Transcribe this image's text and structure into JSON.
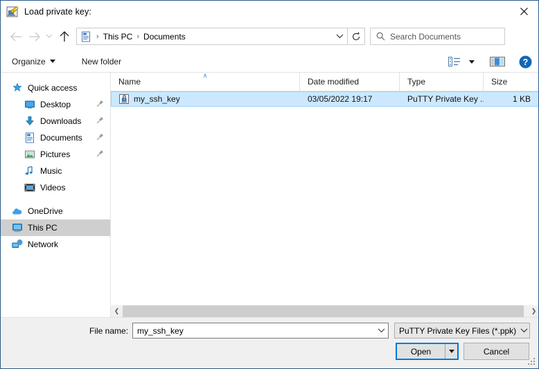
{
  "window": {
    "title": "Load private key:",
    "title_icon": "putty-key-icon",
    "close_label": "✕"
  },
  "nav": {
    "back_icon": "arrow-left-icon",
    "forward_icon": "arrow-right-icon",
    "recent_icon": "chevron-down-icon",
    "up_icon": "arrow-up-icon",
    "address_icon": "documents-folder-icon",
    "breadcrumbs": [
      "This PC",
      "Documents"
    ],
    "separator": "›",
    "dropdown_icon": "chevron-down-icon",
    "refresh_icon": "refresh-icon"
  },
  "search": {
    "placeholder": "Search Documents",
    "icon": "search-icon"
  },
  "toolbar": {
    "organize_label": "Organize",
    "new_folder_label": "New folder",
    "view_icon": "list-view-icon",
    "view_caret_icon": "chevron-down-icon",
    "preview_pane_icon": "preview-pane-icon",
    "help_icon": "help-icon",
    "help_label": "?"
  },
  "sidebar": {
    "items": [
      {
        "label": "Quick access",
        "icon": "star-pin-icon",
        "indent": 0,
        "pinned": false,
        "selected": false
      },
      {
        "label": "Desktop",
        "icon": "desktop-icon",
        "indent": 1,
        "pinned": true,
        "selected": false
      },
      {
        "label": "Downloads",
        "icon": "downloads-icon",
        "indent": 1,
        "pinned": true,
        "selected": false
      },
      {
        "label": "Documents",
        "icon": "documents-icon",
        "indent": 1,
        "pinned": true,
        "selected": false
      },
      {
        "label": "Pictures",
        "icon": "pictures-icon",
        "indent": 1,
        "pinned": true,
        "selected": false
      },
      {
        "label": "Music",
        "icon": "music-icon",
        "indent": 1,
        "pinned": false,
        "selected": false
      },
      {
        "label": "Videos",
        "icon": "videos-icon",
        "indent": 1,
        "pinned": false,
        "selected": false
      },
      {
        "label": "OneDrive",
        "icon": "onedrive-icon",
        "indent": 0,
        "pinned": false,
        "selected": false
      },
      {
        "label": "This PC",
        "icon": "this-pc-icon",
        "indent": 0,
        "pinned": false,
        "selected": true
      },
      {
        "label": "Network",
        "icon": "network-icon",
        "indent": 0,
        "pinned": false,
        "selected": false
      }
    ],
    "pin_glyph": "📌"
  },
  "filelist": {
    "columns": [
      "Name",
      "Date modified",
      "Type",
      "Size"
    ],
    "sort_column": "Name",
    "sort_direction_glyph": "∧",
    "rows": [
      {
        "name": "my_ssh_key",
        "date_modified": "03/05/2022 19:17",
        "type": "PuTTY Private Key ...",
        "size": "1 KB",
        "icon": "ppk-file-icon",
        "selected": true
      }
    ]
  },
  "scrollbar": {
    "left_arrow": "❮",
    "right_arrow": "❯"
  },
  "bottom": {
    "file_name_label": "File name:",
    "file_name_value": "my_ssh_key",
    "file_name_chevron": "chevron-down-icon",
    "filter_value": "PuTTY Private Key Files (*.ppk)",
    "filter_chevron": "chevron-down-icon",
    "open_label": "Open",
    "open_caret": "chevron-down-icon",
    "cancel_label": "Cancel"
  },
  "colors": {
    "accent": "#0078d7",
    "selection": "#cce8ff",
    "selection_border": "#99d1ff",
    "chrome": "#f0f0f0",
    "sidebar_selected": "#cfcfcf"
  }
}
